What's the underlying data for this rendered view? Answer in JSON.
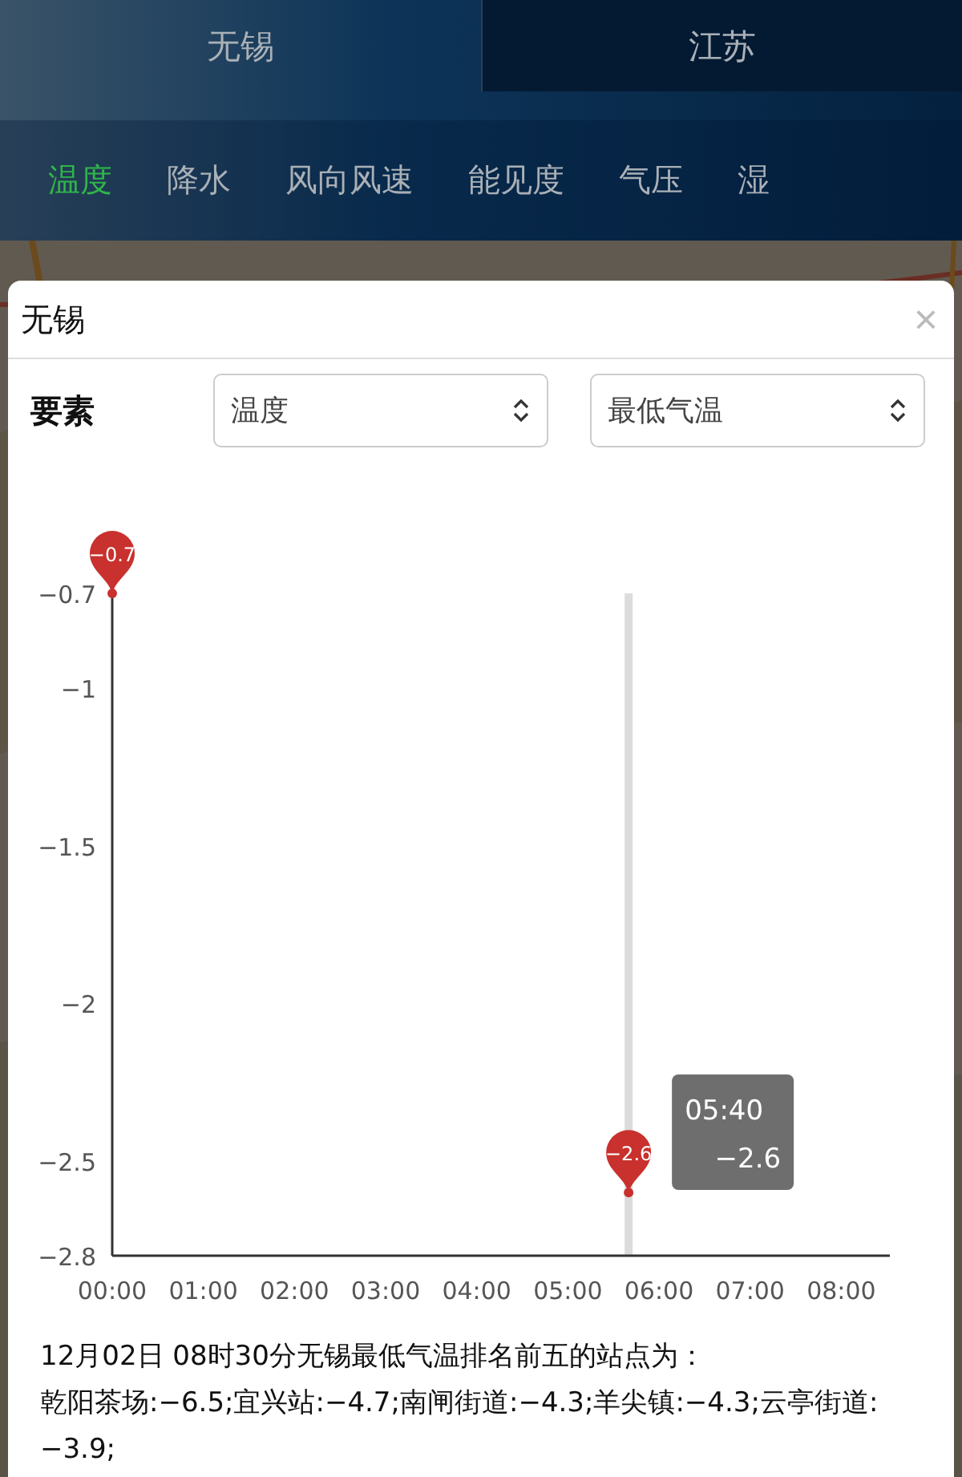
{
  "region_tabs": [
    {
      "label": "无锡",
      "selected": true
    },
    {
      "label": "江苏",
      "selected": false
    }
  ],
  "element_tabs": [
    {
      "label": "温度",
      "selected": true
    },
    {
      "label": "降水",
      "selected": false
    },
    {
      "label": "风向风速",
      "selected": false
    },
    {
      "label": "能见度",
      "selected": false
    },
    {
      "label": "气压",
      "selected": false
    },
    {
      "label": "湿",
      "selected": false
    }
  ],
  "dialog": {
    "title": "无锡",
    "close": "×",
    "field_label": "要素",
    "selects": [
      {
        "value": "温度"
      },
      {
        "value": "最低气温"
      }
    ],
    "chart": {
      "chart_data": {
        "type": "scatter",
        "xlim": [
          0,
          512
        ],
        "ylim": [
          -2.8,
          -0.7
        ],
        "xticks": [
          {
            "value": 0,
            "label": "00:00"
          },
          {
            "value": 60,
            "label": "01:00"
          },
          {
            "value": 120,
            "label": "02:00"
          },
          {
            "value": 180,
            "label": "03:00"
          },
          {
            "value": 240,
            "label": "04:00"
          },
          {
            "value": 300,
            "label": "05:00"
          },
          {
            "value": 360,
            "label": "06:00"
          },
          {
            "value": 420,
            "label": "07:00"
          },
          {
            "value": 480,
            "label": "08:00"
          }
        ],
        "yticks": [
          {
            "value": -0.7,
            "label": "−0.7"
          },
          {
            "value": -1,
            "label": "−1"
          },
          {
            "value": -1.5,
            "label": "−1.5"
          },
          {
            "value": -2,
            "label": "−2"
          },
          {
            "value": -2.5,
            "label": "−2.5"
          },
          {
            "value": -2.8,
            "label": "−2.8"
          }
        ],
        "x": [
          0,
          340
        ],
        "series": [
          {
            "color": "#c8312e",
            "values": [
              -0.7,
              -2.6
            ]
          }
        ],
        "value_labels": [
          "−0.7",
          "−2.6"
        ],
        "ref_lines": [
          {
            "axis": "x",
            "value": 340
          }
        ]
      },
      "tooltip": {
        "time": "05:40",
        "value": "−2.6"
      }
    },
    "summary": [
      "12月02日 08时30分无锡最低气温排名前五的站点为：",
      "乾阳茶场:−6.5;宜兴站:−4.7;南闸街道:−4.3;羊尖镇:−4.3;云亭街道:−3.9;"
    ]
  }
}
